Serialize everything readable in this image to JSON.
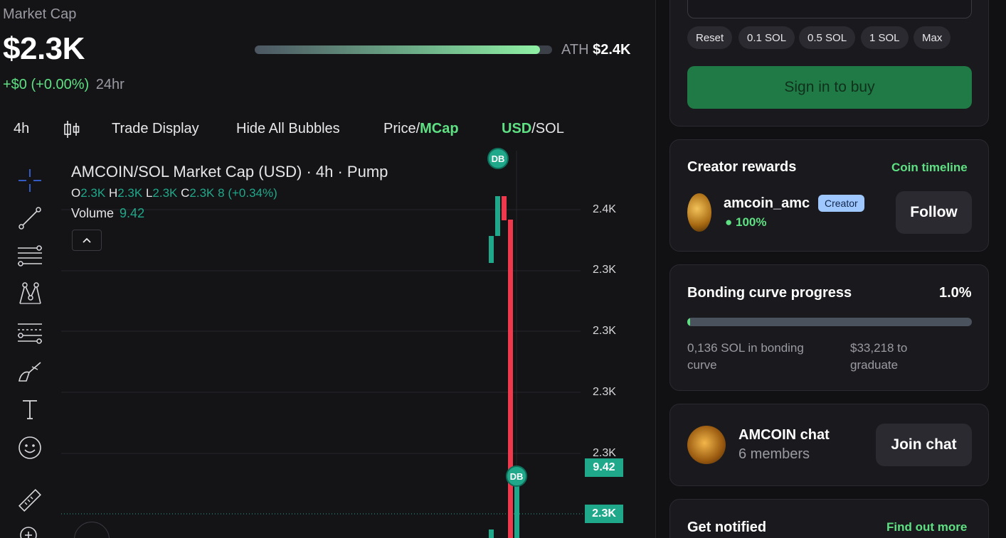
{
  "market": {
    "label": "Market Cap",
    "value": "$2.3K",
    "change_abs": "+$0",
    "change_pct": "(+0.00%)",
    "period": "24hr",
    "ath_label": "ATH",
    "ath_value": "$2.4K",
    "ath_progress_fraction": 0.96
  },
  "toolbar": {
    "interval": "4h",
    "trade_display": "Trade Display",
    "hide_bubbles": "Hide All Bubbles",
    "price_label": "Price",
    "slash": "/",
    "mcap_label": "MCap",
    "usd_label": "USD",
    "sol_label": "SOL"
  },
  "chart": {
    "title": "AMCOIN/SOL Market Cap (USD) · 4h · Pump",
    "o_label": "O",
    "o_val": "2.3K",
    "h_label": "H",
    "h_val": "2.3K",
    "l_label": "L",
    "l_val": "2.3K",
    "c_label": "C",
    "c_val": "2.3K",
    "change": "8 (+0.34%)",
    "volume_label": "Volume",
    "volume_val": "9.42",
    "y_ticks": [
      "2.4K",
      "2.3K",
      "2.3K",
      "2.3K",
      "2.3K"
    ],
    "tag_volume": "9.42",
    "tag_price": "2.3K",
    "marker_label": "DB",
    "collapse_glyph": "^",
    "colors": {
      "up": "#1fa88a",
      "down": "#f0384d"
    }
  },
  "trade": {
    "chips": [
      "Reset",
      "0.1 SOL",
      "0.5 SOL",
      "1 SOL",
      "Max"
    ],
    "buy_label": "Sign in to buy"
  },
  "creator": {
    "heading": "Creator rewards",
    "timeline_link": "Coin timeline",
    "name": "amcoin_amc",
    "badge": "Creator",
    "share": "100%",
    "follow_label": "Follow"
  },
  "bonding": {
    "heading": "Bonding curve progress",
    "percent": "1.0%",
    "progress_fraction": 0.01,
    "sol_text": "0,136 SOL in bonding curve",
    "graduate_text": "$33,218 to graduate"
  },
  "chat": {
    "title": "AMCOIN chat",
    "members": "6 members",
    "join_label": "Join chat"
  },
  "notify": {
    "heading": "Get notified",
    "link": "Find out more"
  }
}
